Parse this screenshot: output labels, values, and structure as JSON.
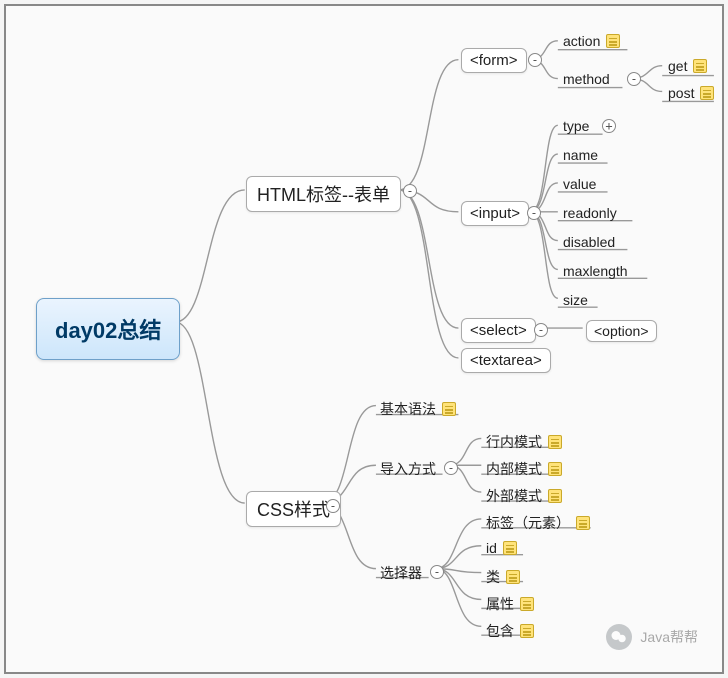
{
  "root": {
    "label": "day02总结"
  },
  "branch1": {
    "label": "HTML标签--表单",
    "children": {
      "form": {
        "label": "<form>",
        "children": {
          "action": "action",
          "method": {
            "label": "method",
            "get": "get",
            "post": "post"
          }
        }
      },
      "input": {
        "label": "<input>",
        "children": {
          "type": "type",
          "name": "name",
          "value": "value",
          "readonly": "readonly",
          "disabled": "disabled",
          "maxlength": "maxlength",
          "size": "size"
        }
      },
      "select": {
        "label": "<select>",
        "option": "<option>"
      },
      "textarea": {
        "label": "<textarea>"
      }
    }
  },
  "branch2": {
    "label": "CSS样式",
    "children": {
      "basic": "基本语法",
      "import": {
        "label": "导入方式",
        "inline": "行内模式",
        "internal": "内部模式",
        "external": "外部模式"
      },
      "selector": {
        "label": "选择器",
        "tag": "标签（元素）",
        "id": "id",
        "class": "类",
        "attr": "属性",
        "contain": "包含"
      }
    }
  },
  "watermark": "Java帮帮"
}
